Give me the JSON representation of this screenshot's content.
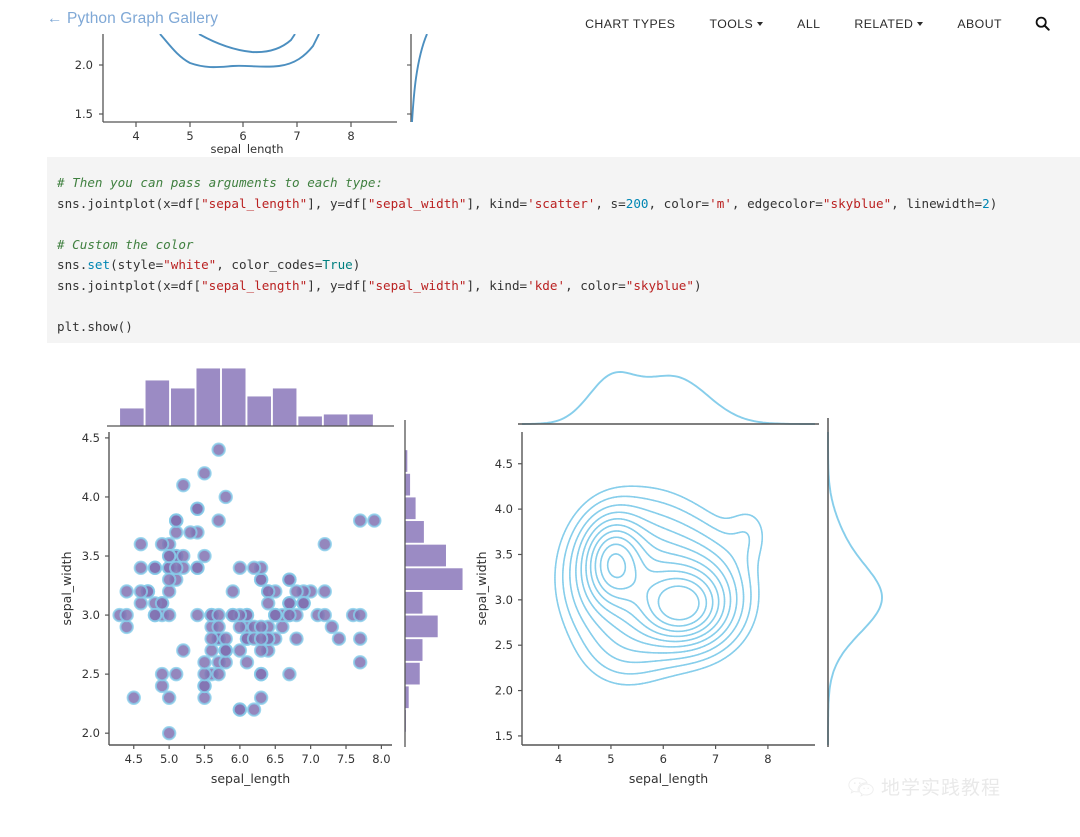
{
  "header": {
    "brand": "← Python Graph Gallery",
    "brand_color": "#7fa8d6",
    "nav": [
      {
        "label": "CHART TYPES",
        "has_caret": false,
        "name": "nav-chart-types"
      },
      {
        "label": "TOOLS",
        "has_caret": true,
        "name": "nav-tools"
      },
      {
        "label": "ALL",
        "has_caret": false,
        "name": "nav-all"
      },
      {
        "label": "RELATED",
        "has_caret": true,
        "name": "nav-related"
      },
      {
        "label": "ABOUT",
        "has_caret": false,
        "name": "nav-about"
      }
    ],
    "search_icon": "search-icon"
  },
  "code": {
    "background": "#f4f4f4",
    "lines": [
      [
        {
          "t": "# Then you can pass arguments to each type:",
          "c": "cm"
        }
      ],
      [
        {
          "t": "sns.jointplot(x=df[",
          "c": ""
        },
        {
          "t": "\"sepal_length\"",
          "c": "st"
        },
        {
          "t": "], y=df[",
          "c": ""
        },
        {
          "t": "\"sepal_width\"",
          "c": "st"
        },
        {
          "t": "], kind=",
          "c": ""
        },
        {
          "t": "'scatter'",
          "c": "st"
        },
        {
          "t": ", s=",
          "c": ""
        },
        {
          "t": "200",
          "c": "num"
        },
        {
          "t": ", color=",
          "c": ""
        },
        {
          "t": "'m'",
          "c": "st"
        },
        {
          "t": ", edgecolor=",
          "c": ""
        },
        {
          "t": "\"skyblue\"",
          "c": "st"
        },
        {
          "t": ", linewidth=",
          "c": ""
        },
        {
          "t": "2",
          "c": "num"
        },
        {
          "t": ")",
          "c": ""
        }
      ],
      [],
      [
        {
          "t": "# Custom the color",
          "c": "cm"
        }
      ],
      [
        {
          "t": "sns.",
          "c": ""
        },
        {
          "t": "set",
          "c": "fn"
        },
        {
          "t": "(style=",
          "c": ""
        },
        {
          "t": "\"white\"",
          "c": "st"
        },
        {
          "t": ", color_codes=",
          "c": ""
        },
        {
          "t": "True",
          "c": "nb"
        },
        {
          "t": ")",
          "c": ""
        }
      ],
      [
        {
          "t": "sns.jointplot(x=df[",
          "c": ""
        },
        {
          "t": "\"sepal_length\"",
          "c": "st"
        },
        {
          "t": "], y=df[",
          "c": ""
        },
        {
          "t": "\"sepal_width\"",
          "c": "st"
        },
        {
          "t": "], kind=",
          "c": ""
        },
        {
          "t": "'kde'",
          "c": "st"
        },
        {
          "t": ", color=",
          "c": ""
        },
        {
          "t": "\"skyblue\"",
          "c": "st"
        },
        {
          "t": ")",
          "c": ""
        }
      ],
      [],
      [
        {
          "t": "plt.show()",
          "c": ""
        }
      ]
    ]
  },
  "watermark": {
    "icon": "wechat-icon",
    "text": "地学实践教程"
  },
  "chart_data": [
    {
      "id": "top-cropped-kde",
      "type": "line",
      "title": "",
      "xlabel": "sepal_length",
      "ylabel": "",
      "note": "Bottom fragment of a previous seaborn kde jointplot, cropped by the viewport",
      "xlim": [
        3.3,
        8.9
      ],
      "ylim": [
        1.45,
        2.25
      ],
      "xticks": [
        4,
        5,
        6,
        7,
        8
      ],
      "yticks": [
        1.5,
        2.0
      ],
      "line_color": "#4c8fc0",
      "grid": false,
      "contours": [
        {
          "name": "outer",
          "x": [
            4.4,
            4.7,
            5.0,
            5.3,
            5.6,
            5.9,
            6.2,
            6.5,
            6.8
          ],
          "y": [
            2.25,
            2.09,
            1.99,
            1.98,
            2.01,
            1.97,
            1.97,
            2.05,
            2.25
          ]
        },
        {
          "name": "inner",
          "x": [
            5.25,
            5.5,
            5.8,
            6.1,
            6.35
          ],
          "y": [
            2.25,
            2.2,
            2.18,
            2.16,
            2.25
          ]
        }
      ],
      "marginal_right": {
        "x": [
          0.0,
          0.05,
          0.35,
          1.0
        ],
        "y": [
          1.5,
          1.62,
          1.95,
          2.25
        ]
      }
    },
    {
      "id": "scatter-jointplot",
      "type": "scatter",
      "title": "",
      "xlabel": "sepal_length",
      "ylabel": "sepal_width",
      "xlim": [
        4.15,
        8.15
      ],
      "ylim": [
        1.9,
        4.55
      ],
      "xticks": [
        4.5,
        5.0,
        5.5,
        6.0,
        6.5,
        7.0,
        7.5,
        8.0
      ],
      "yticks": [
        2.0,
        2.5,
        3.0,
        3.5,
        4.0,
        4.5
      ],
      "marker_color": "#8172b2",
      "marker_edge_color": "#87ceeb",
      "marker_size": 200,
      "marker_linewidth": 2,
      "grid": false,
      "points": [
        [
          5.1,
          3.5
        ],
        [
          4.9,
          3.0
        ],
        [
          4.7,
          3.2
        ],
        [
          4.6,
          3.1
        ],
        [
          5.0,
          3.6
        ],
        [
          5.4,
          3.9
        ],
        [
          4.6,
          3.4
        ],
        [
          5.0,
          3.4
        ],
        [
          4.4,
          2.9
        ],
        [
          4.9,
          3.1
        ],
        [
          5.4,
          3.7
        ],
        [
          4.8,
          3.4
        ],
        [
          4.8,
          3.0
        ],
        [
          4.3,
          3.0
        ],
        [
          5.8,
          4.0
        ],
        [
          5.7,
          4.4
        ],
        [
          5.4,
          3.9
        ],
        [
          5.1,
          3.5
        ],
        [
          5.7,
          3.8
        ],
        [
          5.1,
          3.8
        ],
        [
          5.4,
          3.4
        ],
        [
          5.1,
          3.7
        ],
        [
          4.6,
          3.6
        ],
        [
          5.1,
          3.3
        ],
        [
          4.8,
          3.4
        ],
        [
          5.0,
          3.0
        ],
        [
          5.0,
          3.4
        ],
        [
          5.2,
          3.5
        ],
        [
          5.2,
          3.4
        ],
        [
          4.7,
          3.2
        ],
        [
          4.8,
          3.1
        ],
        [
          5.4,
          3.4
        ],
        [
          5.2,
          4.1
        ],
        [
          5.5,
          4.2
        ],
        [
          4.9,
          3.1
        ],
        [
          5.0,
          3.2
        ],
        [
          5.5,
          3.5
        ],
        [
          4.9,
          3.6
        ],
        [
          4.4,
          3.0
        ],
        [
          5.1,
          3.4
        ],
        [
          5.0,
          3.5
        ],
        [
          4.5,
          2.3
        ],
        [
          4.4,
          3.2
        ],
        [
          5.0,
          3.5
        ],
        [
          5.1,
          3.8
        ],
        [
          4.8,
          3.0
        ],
        [
          5.1,
          3.8
        ],
        [
          4.6,
          3.2
        ],
        [
          5.3,
          3.7
        ],
        [
          5.0,
          3.3
        ],
        [
          7.0,
          3.2
        ],
        [
          6.4,
          3.2
        ],
        [
          6.9,
          3.1
        ],
        [
          5.5,
          2.3
        ],
        [
          6.5,
          2.8
        ],
        [
          5.7,
          2.8
        ],
        [
          6.3,
          3.3
        ],
        [
          4.9,
          2.4
        ],
        [
          6.6,
          2.9
        ],
        [
          5.2,
          2.7
        ],
        [
          5.0,
          2.0
        ],
        [
          5.9,
          3.0
        ],
        [
          6.0,
          2.2
        ],
        [
          6.1,
          2.9
        ],
        [
          5.6,
          2.9
        ],
        [
          6.7,
          3.1
        ],
        [
          5.6,
          3.0
        ],
        [
          5.8,
          2.7
        ],
        [
          6.2,
          2.2
        ],
        [
          5.6,
          2.5
        ],
        [
          5.9,
          3.2
        ],
        [
          6.1,
          2.8
        ],
        [
          6.3,
          2.5
        ],
        [
          6.1,
          2.8
        ],
        [
          6.4,
          2.9
        ],
        [
          6.6,
          3.0
        ],
        [
          6.8,
          2.8
        ],
        [
          6.7,
          3.0
        ],
        [
          6.0,
          2.9
        ],
        [
          5.7,
          2.6
        ],
        [
          5.5,
          2.4
        ],
        [
          5.5,
          2.4
        ],
        [
          5.8,
          2.7
        ],
        [
          6.0,
          2.7
        ],
        [
          5.4,
          3.0
        ],
        [
          6.0,
          3.4
        ],
        [
          6.7,
          3.1
        ],
        [
          6.3,
          2.3
        ],
        [
          5.6,
          3.0
        ],
        [
          5.5,
          2.5
        ],
        [
          5.5,
          2.6
        ],
        [
          6.1,
          3.0
        ],
        [
          5.8,
          2.6
        ],
        [
          5.0,
          2.3
        ],
        [
          5.6,
          2.7
        ],
        [
          5.7,
          3.0
        ],
        [
          5.7,
          2.9
        ],
        [
          6.2,
          2.9
        ],
        [
          5.1,
          2.5
        ],
        [
          5.7,
          2.8
        ],
        [
          6.3,
          3.3
        ],
        [
          5.8,
          2.7
        ],
        [
          7.1,
          3.0
        ],
        [
          6.3,
          2.9
        ],
        [
          6.5,
          3.0
        ],
        [
          7.6,
          3.0
        ],
        [
          4.9,
          2.5
        ],
        [
          7.3,
          2.9
        ],
        [
          6.7,
          2.5
        ],
        [
          7.2,
          3.6
        ],
        [
          6.5,
          3.2
        ],
        [
          6.4,
          2.7
        ],
        [
          6.8,
          3.0
        ],
        [
          5.7,
          2.5
        ],
        [
          5.8,
          2.8
        ],
        [
          6.4,
          3.2
        ],
        [
          6.5,
          3.0
        ],
        [
          7.7,
          3.8
        ],
        [
          7.7,
          2.6
        ],
        [
          6.0,
          2.2
        ],
        [
          6.9,
          3.2
        ],
        [
          5.6,
          2.8
        ],
        [
          7.7,
          2.8
        ],
        [
          6.3,
          2.7
        ],
        [
          6.7,
          3.3
        ],
        [
          7.2,
          3.2
        ],
        [
          6.2,
          2.8
        ],
        [
          6.1,
          3.0
        ],
        [
          6.4,
          2.8
        ],
        [
          7.2,
          3.0
        ],
        [
          7.4,
          2.8
        ],
        [
          7.9,
          3.8
        ],
        [
          6.4,
          2.8
        ],
        [
          6.3,
          2.8
        ],
        [
          6.1,
          2.6
        ],
        [
          7.7,
          3.0
        ],
        [
          6.3,
          3.4
        ],
        [
          6.4,
          3.1
        ],
        [
          6.0,
          3.0
        ],
        [
          6.9,
          3.1
        ],
        [
          6.7,
          3.1
        ],
        [
          6.9,
          3.1
        ],
        [
          5.8,
          2.7
        ],
        [
          6.8,
          3.2
        ],
        [
          6.7,
          3.3
        ],
        [
          6.7,
          3.0
        ],
        [
          6.3,
          2.5
        ],
        [
          6.5,
          3.0
        ],
        [
          6.2,
          3.4
        ],
        [
          5.9,
          3.0
        ]
      ],
      "marginal_top": {
        "type": "histogram",
        "bar_color": "#9b8bc4",
        "bin_edges": [
          4.3,
          4.66,
          5.02,
          5.38,
          5.74,
          6.1,
          6.46,
          6.82,
          7.18,
          7.54,
          7.9
        ],
        "counts": [
          9,
          23,
          19,
          29,
          29,
          15,
          19,
          5,
          6,
          6
        ]
      },
      "marginal_right": {
        "type": "histogram",
        "bar_color": "#9b8bc4",
        "bin_edges": [
          2.0,
          2.2,
          2.4,
          2.6,
          2.8,
          3.0,
          3.2,
          3.4,
          3.6,
          3.8,
          4.0,
          4.2,
          4.4
        ],
        "counts": [
          1,
          3,
          11,
          13,
          24,
          13,
          42,
          30,
          14,
          8,
          4,
          2
        ]
      }
    },
    {
      "id": "kde-jointplot",
      "type": "line",
      "title": "",
      "xlabel": "sepal_length",
      "ylabel": "sepal_width",
      "xlim": [
        3.3,
        8.9
      ],
      "ylim": [
        1.4,
        4.85
      ],
      "xticks": [
        4,
        5,
        6,
        7,
        8
      ],
      "yticks": [
        1.5,
        2.0,
        2.5,
        3.0,
        3.5,
        4.0,
        4.5
      ],
      "line_color": "#87ceeb",
      "grid": false,
      "contour_levels": 10,
      "marginal_top": {
        "type": "kde",
        "peak_x": 5.6,
        "span": [
          3.5,
          8.6
        ]
      },
      "marginal_right": {
        "type": "kde",
        "peak_y": 3.05,
        "span": [
          1.9,
          4.6
        ]
      }
    }
  ]
}
